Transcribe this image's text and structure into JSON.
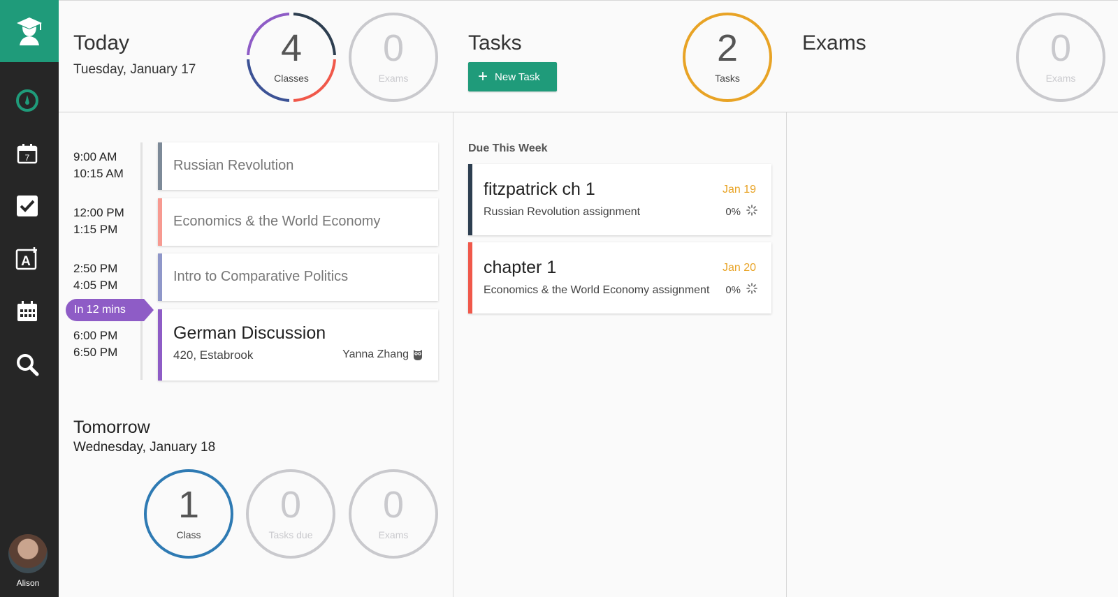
{
  "sidebar": {
    "logo_icon": "graduate-icon",
    "items": [
      {
        "icon": "dashboard-icon"
      },
      {
        "icon": "calendar-day-icon",
        "date_num": "7"
      },
      {
        "icon": "checkbox-icon"
      },
      {
        "icon": "add-exam-icon"
      },
      {
        "icon": "calendar-month-icon"
      },
      {
        "icon": "search-icon"
      }
    ],
    "user": {
      "name": "Alison"
    }
  },
  "today": {
    "title": "Today",
    "date": "Tuesday, January 17",
    "classes_count": "4",
    "classes_label": "Classes",
    "exams_count": "0",
    "exams_label": "Exams",
    "ring_colors": [
      "#2d3e50",
      "#f0584a",
      "#3c5295",
      "#8e5cc6"
    ]
  },
  "tasks_header": {
    "title": "Tasks",
    "new_task_label": "New Task",
    "count": "2",
    "count_label": "Tasks",
    "ring_color": "#e8a325"
  },
  "exams_header": {
    "title": "Exams",
    "count": "0",
    "count_label": "Exams"
  },
  "schedule": [
    {
      "start": "9:00 AM",
      "end": "10:15 AM",
      "name": "Russian Revolution",
      "color": "#7d8a98"
    },
    {
      "start": "12:00 PM",
      "end": "1:15 PM",
      "name": "Economics & the World Economy",
      "color": "#f79a91"
    },
    {
      "start": "2:50 PM",
      "end": "4:05 PM",
      "name": "Intro to Comparative Politics",
      "color": "#8f97c9"
    },
    {
      "start": "6:00 PM",
      "end": "6:50 PM",
      "name": "German Discussion",
      "color": "#8e5cc6",
      "location": "420, Estabrook",
      "professor": "Yanna Zhang"
    }
  ],
  "next_badge": "In 12 mins",
  "tomorrow": {
    "title": "Tomorrow",
    "date": "Wednesday, January 18",
    "class_count": "1",
    "class_label": "Class",
    "tasks_count": "0",
    "tasks_label": "Tasks due",
    "exams_count": "0",
    "exams_label": "Exams",
    "ring_color": "#2e7ab3"
  },
  "tasks": {
    "section_title": "Due This Week",
    "items": [
      {
        "title": "fitzpatrick ch 1",
        "course": "Russian Revolution assignment",
        "due": "Jan 19",
        "progress": "0%",
        "color": "#2d3e50"
      },
      {
        "title": "chapter 1",
        "course": "Economics & the World Economy assignment",
        "due": "Jan 20",
        "progress": "0%",
        "color": "#f0584a"
      }
    ]
  }
}
